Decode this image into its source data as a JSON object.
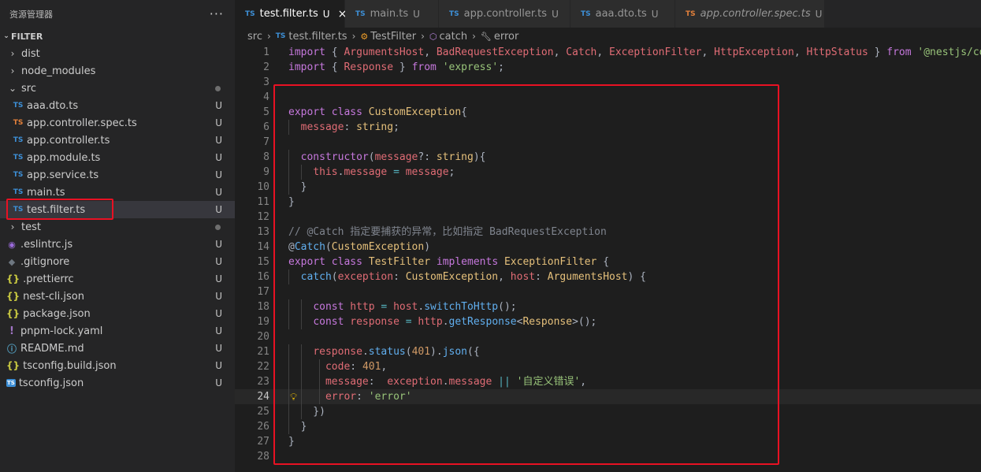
{
  "sidebar": {
    "title": "资源管理器",
    "more": "···",
    "folder": "FILTER",
    "items": [
      {
        "depth": 0,
        "kind": "folder",
        "name": "dist",
        "expanded": false
      },
      {
        "depth": 0,
        "kind": "folder",
        "name": "node_modules",
        "expanded": false
      },
      {
        "depth": 0,
        "kind": "folder",
        "name": "src",
        "expanded": true,
        "dot": true
      },
      {
        "depth": 1,
        "kind": "ts",
        "icon": "TS",
        "name": "aaa.dto.ts",
        "status": "U"
      },
      {
        "depth": 1,
        "kind": "ts-spec",
        "icon": "TS",
        "name": "app.controller.spec.ts",
        "status": "U"
      },
      {
        "depth": 1,
        "kind": "ts",
        "icon": "TS",
        "name": "app.controller.ts",
        "status": "U"
      },
      {
        "depth": 1,
        "kind": "ts",
        "icon": "TS",
        "name": "app.module.ts",
        "status": "U"
      },
      {
        "depth": 1,
        "kind": "ts",
        "icon": "TS",
        "name": "app.service.ts",
        "status": "U"
      },
      {
        "depth": 1,
        "kind": "ts",
        "icon": "TS",
        "name": "main.ts",
        "status": "U"
      },
      {
        "depth": 1,
        "kind": "ts",
        "icon": "TS",
        "name": "test.filter.ts",
        "status": "U",
        "selected": true
      },
      {
        "depth": 0,
        "kind": "folder",
        "name": "test",
        "expanded": false,
        "dot": true
      },
      {
        "depth": 0,
        "kind": "eslint",
        "icon": "◉",
        "name": ".eslintrc.js",
        "status": "U"
      },
      {
        "depth": 0,
        "kind": "git",
        "icon": "◆",
        "name": ".gitignore",
        "status": "U"
      },
      {
        "depth": 0,
        "kind": "json",
        "icon": "{}",
        "name": ".prettierrc",
        "status": "U"
      },
      {
        "depth": 0,
        "kind": "json",
        "icon": "{}",
        "name": "nest-cli.json",
        "status": "U"
      },
      {
        "depth": 0,
        "kind": "json",
        "icon": "{}",
        "name": "package.json",
        "status": "U"
      },
      {
        "depth": 0,
        "kind": "yaml",
        "icon": "!",
        "name": "pnpm-lock.yaml",
        "status": "U"
      },
      {
        "depth": 0,
        "kind": "info",
        "icon": "ⓘ",
        "name": "README.md",
        "status": "U"
      },
      {
        "depth": 0,
        "kind": "json",
        "icon": "{}",
        "name": "tsconfig.build.json",
        "status": "U"
      },
      {
        "depth": 0,
        "kind": "tsconf",
        "icon": "TS",
        "name": "tsconfig.json",
        "status": "U"
      }
    ]
  },
  "tabs": [
    {
      "icon": "TS",
      "label": "test.filter.ts",
      "status": "U",
      "active": true,
      "close": "×"
    },
    {
      "icon": "TS",
      "label": "main.ts",
      "status": "U"
    },
    {
      "icon": "TS",
      "label": "app.controller.ts",
      "status": "U"
    },
    {
      "icon": "TS",
      "label": "aaa.dto.ts",
      "status": "U"
    },
    {
      "icon": "TS",
      "label": "app.controller.spec.ts",
      "status": "U",
      "spec": true,
      "italic": true
    }
  ],
  "breadcrumb": {
    "parts": [
      "src",
      "test.filter.ts",
      "TestFilter",
      "catch",
      "error"
    ],
    "file_icon": "TS"
  },
  "editor": {
    "current_line": 24,
    "lines": [
      [
        [
          "kw",
          "import"
        ],
        [
          "pn",
          " { "
        ],
        [
          "ident",
          "ArgumentsHost"
        ],
        [
          "pn",
          ", "
        ],
        [
          "ident",
          "BadRequestException"
        ],
        [
          "pn",
          ", "
        ],
        [
          "ident",
          "Catch"
        ],
        [
          "pn",
          ", "
        ],
        [
          "ident",
          "ExceptionFilter"
        ],
        [
          "pn",
          ", "
        ],
        [
          "ident",
          "HttpException"
        ],
        [
          "pn",
          ", "
        ],
        [
          "ident",
          "HttpStatus"
        ],
        [
          "pn",
          " } "
        ],
        [
          "kw",
          "from"
        ],
        [
          "pn",
          " "
        ],
        [
          "str",
          "'@nestjs/common'"
        ],
        [
          "pn",
          ";"
        ]
      ],
      [
        [
          "kw",
          "import"
        ],
        [
          "pn",
          " { "
        ],
        [
          "ident",
          "Response"
        ],
        [
          "pn",
          " } "
        ],
        [
          "kw",
          "from"
        ],
        [
          "pn",
          " "
        ],
        [
          "str",
          "'express'"
        ],
        [
          "pn",
          ";"
        ]
      ],
      [],
      [],
      [
        [
          "kw",
          "export"
        ],
        [
          "pn",
          " "
        ],
        [
          "kw",
          "class"
        ],
        [
          "pn",
          " "
        ],
        [
          "cls",
          "CustomException"
        ],
        [
          "pn",
          "{"
        ]
      ],
      [
        [
          "pn",
          "  "
        ],
        [
          "ident",
          "message"
        ],
        [
          "pn",
          ": "
        ],
        [
          "cls",
          "string"
        ],
        [
          "pn",
          ";"
        ]
      ],
      [],
      [
        [
          "pn",
          "  "
        ],
        [
          "kw",
          "constructor"
        ],
        [
          "pn",
          "("
        ],
        [
          "ident",
          "message"
        ],
        [
          "pn",
          "?: "
        ],
        [
          "cls",
          "string"
        ],
        [
          "pn",
          "){"
        ]
      ],
      [
        [
          "pn",
          "    "
        ],
        [
          "ident",
          "this"
        ],
        [
          "pn",
          "."
        ],
        [
          "ident",
          "message"
        ],
        [
          "pn",
          " "
        ],
        [
          "op",
          "="
        ],
        [
          "pn",
          " "
        ],
        [
          "ident",
          "message"
        ],
        [
          "pn",
          ";"
        ]
      ],
      [
        [
          "pn",
          "  }"
        ]
      ],
      [
        [
          "pn",
          "}"
        ]
      ],
      [],
      [
        [
          "cm",
          "// @Catch 指定要捕获的异常，比如指定 BadRequestException"
        ]
      ],
      [
        [
          "pn",
          "@"
        ],
        [
          "fn",
          "Catch"
        ],
        [
          "pn",
          "("
        ],
        [
          "cls",
          "CustomException"
        ],
        [
          "pn",
          ")"
        ]
      ],
      [
        [
          "kw",
          "export"
        ],
        [
          "pn",
          " "
        ],
        [
          "kw",
          "class"
        ],
        [
          "pn",
          " "
        ],
        [
          "cls",
          "TestFilter"
        ],
        [
          "pn",
          " "
        ],
        [
          "kw",
          "implements"
        ],
        [
          "pn",
          " "
        ],
        [
          "cls",
          "ExceptionFilter"
        ],
        [
          "pn",
          " {"
        ]
      ],
      [
        [
          "pn",
          "  "
        ],
        [
          "fn",
          "catch"
        ],
        [
          "pn",
          "("
        ],
        [
          "ident",
          "exception"
        ],
        [
          "pn",
          ": "
        ],
        [
          "cls",
          "CustomException"
        ],
        [
          "pn",
          ", "
        ],
        [
          "ident",
          "host"
        ],
        [
          "pn",
          ": "
        ],
        [
          "cls",
          "ArgumentsHost"
        ],
        [
          "pn",
          ") {"
        ]
      ],
      [],
      [
        [
          "pn",
          "    "
        ],
        [
          "kw",
          "const"
        ],
        [
          "pn",
          " "
        ],
        [
          "ident",
          "http"
        ],
        [
          "pn",
          " "
        ],
        [
          "op",
          "="
        ],
        [
          "pn",
          " "
        ],
        [
          "ident",
          "host"
        ],
        [
          "pn",
          "."
        ],
        [
          "fn",
          "switchToHttp"
        ],
        [
          "pn",
          "();"
        ]
      ],
      [
        [
          "pn",
          "    "
        ],
        [
          "kw",
          "const"
        ],
        [
          "pn",
          " "
        ],
        [
          "ident",
          "response"
        ],
        [
          "pn",
          " "
        ],
        [
          "op",
          "="
        ],
        [
          "pn",
          " "
        ],
        [
          "ident",
          "http"
        ],
        [
          "pn",
          "."
        ],
        [
          "fn",
          "getResponse"
        ],
        [
          "pn",
          "<"
        ],
        [
          "cls",
          "Response"
        ],
        [
          "pn",
          ">();"
        ]
      ],
      [],
      [
        [
          "pn",
          "    "
        ],
        [
          "ident",
          "response"
        ],
        [
          "pn",
          "."
        ],
        [
          "fn",
          "status"
        ],
        [
          "pn",
          "("
        ],
        [
          "num",
          "401"
        ],
        [
          "pn",
          ")."
        ],
        [
          "fn",
          "json"
        ],
        [
          "pn",
          "({"
        ]
      ],
      [
        [
          "pn",
          "      "
        ],
        [
          "ident",
          "code"
        ],
        [
          "pn",
          ": "
        ],
        [
          "num",
          "401"
        ],
        [
          "pn",
          ","
        ]
      ],
      [
        [
          "pn",
          "      "
        ],
        [
          "ident",
          "message"
        ],
        [
          "pn",
          ":  "
        ],
        [
          "ident",
          "exception"
        ],
        [
          "pn",
          "."
        ],
        [
          "ident",
          "message"
        ],
        [
          "pn",
          " "
        ],
        [
          "op",
          "||"
        ],
        [
          "pn",
          " "
        ],
        [
          "str",
          "'自定义错误'"
        ],
        [
          "pn",
          ","
        ]
      ],
      [
        [
          "pn",
          "      "
        ],
        [
          "ident",
          "error"
        ],
        [
          "pn",
          ": "
        ],
        [
          "str",
          "'error'"
        ]
      ],
      [
        [
          "pn",
          "    })"
        ]
      ],
      [
        [
          "pn",
          "  }"
        ]
      ],
      [
        [
          "pn",
          "}"
        ]
      ],
      []
    ]
  }
}
